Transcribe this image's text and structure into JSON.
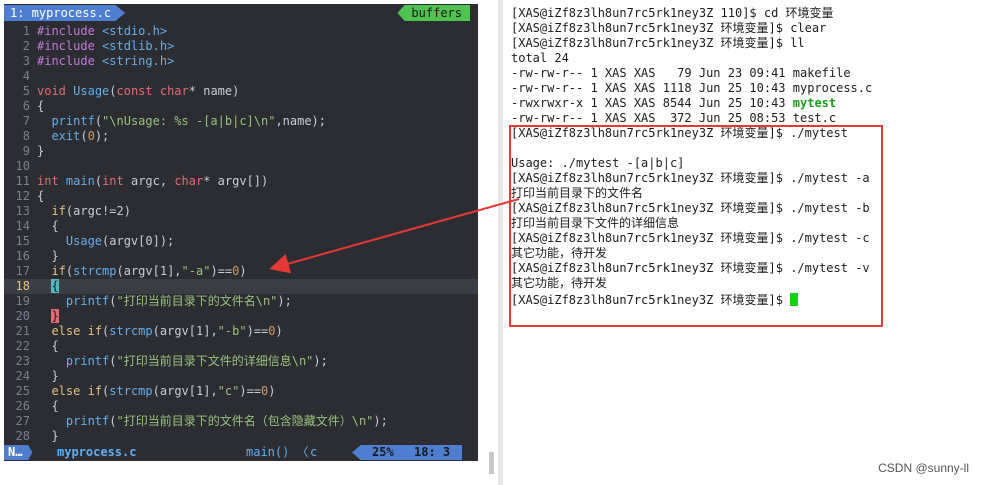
{
  "editor": {
    "tab_active": "1: myprocess.c",
    "tab_buffers": "buffers",
    "lines": [
      {
        "n": "1",
        "text": "#include <stdio.h>",
        "type": "include"
      },
      {
        "n": "2",
        "text": "#include <stdlib.h>",
        "type": "include"
      },
      {
        "n": "3",
        "text": "#include <string.h>",
        "type": "include"
      },
      {
        "n": "4",
        "text": "",
        "type": "plain"
      },
      {
        "n": "5",
        "text": "void Usage(const char* name)",
        "type": "code"
      },
      {
        "n": "6",
        "text": "{",
        "type": "code"
      },
      {
        "n": "7",
        "text": "  printf(\"\\nUsage: %s -[a|b|c]\\n\",name);",
        "type": "code"
      },
      {
        "n": "8",
        "text": "  exit(0);",
        "type": "code"
      },
      {
        "n": "9",
        "text": "}",
        "type": "code"
      },
      {
        "n": "10",
        "text": "",
        "type": "plain"
      },
      {
        "n": "11",
        "text": "int main(int argc, char* argv[])",
        "type": "code"
      },
      {
        "n": "12",
        "text": "{",
        "type": "code"
      },
      {
        "n": "13",
        "text": "  if(argc!=2)",
        "type": "code"
      },
      {
        "n": "14",
        "text": "  {",
        "type": "code"
      },
      {
        "n": "15",
        "text": "    Usage(argv[0]);",
        "type": "code"
      },
      {
        "n": "16",
        "text": "  }",
        "type": "code"
      },
      {
        "n": "17",
        "text": "  if(strcmp(argv[1],\"-a\")==0)",
        "type": "code"
      },
      {
        "n": "18",
        "text": "  {",
        "type": "code",
        "current": true
      },
      {
        "n": "19",
        "text": "    printf(\"打印当前目录下的文件名\\n\");",
        "type": "code"
      },
      {
        "n": "20",
        "text": "  }",
        "type": "code"
      },
      {
        "n": "21",
        "text": "  else if(strcmp(argv[1],\"-b\")==0)",
        "type": "code"
      },
      {
        "n": "22",
        "text": "  {",
        "type": "code"
      },
      {
        "n": "23",
        "text": "    printf(\"打印当前目录下文件的详细信息\\n\");",
        "type": "code"
      },
      {
        "n": "24",
        "text": "  }",
        "type": "code"
      },
      {
        "n": "25",
        "text": "  else if(strcmp(argv[1],\"c\")==0)",
        "type": "code"
      },
      {
        "n": "26",
        "text": "  {",
        "type": "code"
      },
      {
        "n": "27",
        "text": "    printf(\"打印当前目录下的文件名（包含隐藏文件）\\n\");",
        "type": "code"
      },
      {
        "n": "28",
        "text": "  }",
        "type": "code"
      }
    ],
    "status": {
      "mode": "N…",
      "file": "myprocess.c",
      "func": "main() 〈",
      "filetype": "c",
      "percent": "25%",
      "rowcol": "18:  3"
    }
  },
  "terminal": {
    "lines": [
      "[XAS@iZf8z3lh8un7rc5rk1ney3Z 110]$ cd 环境变量",
      "[XAS@iZf8z3lh8un7rc5rk1ney3Z 环境变量]$ clear",
      "[XAS@iZf8z3lh8un7rc5rk1ney3Z 环境变量]$ ll",
      "total 24",
      "-rw-rw-r-- 1 XAS XAS   79 Jun 23 09:41 makefile",
      "-rw-rw-r-- 1 XAS XAS 1118 Jun 25 10:43 myprocess.c",
      "-rwxrwxr-x 1 XAS XAS 8544 Jun 25 10:43 ",
      "-rw-rw-r-- 1 XAS XAS  372 Jun 25 08:53 test.c",
      "[XAS@iZf8z3lh8un7rc5rk1ney3Z 环境变量]$ ./mytest",
      "",
      "Usage: ./mytest -[a|b|c]",
      "[XAS@iZf8z3lh8un7rc5rk1ney3Z 环境变量]$ ./mytest -a",
      "打印当前目录下的文件名",
      "[XAS@iZf8z3lh8un7rc5rk1ney3Z 环境变量]$ ./mytest -b",
      "打印当前目录下文件的详细信息",
      "[XAS@iZf8z3lh8un7rc5rk1ney3Z 环境变量]$ ./mytest -c",
      "其它功能，待开发",
      "[XAS@iZf8z3lh8un7rc5rk1ney3Z 环境变量]$ ./mytest -v",
      "其它功能，待开发",
      "[XAS@iZf8z3lh8un7rc5rk1ney3Z 环境变量]$ "
    ],
    "exec_name": "mytest"
  },
  "watermark": "CSDN @sunny-ll",
  "colors": {
    "annotation_red": "#e53935",
    "cursor_green": "#18d018",
    "exec_green": "#18a018"
  }
}
